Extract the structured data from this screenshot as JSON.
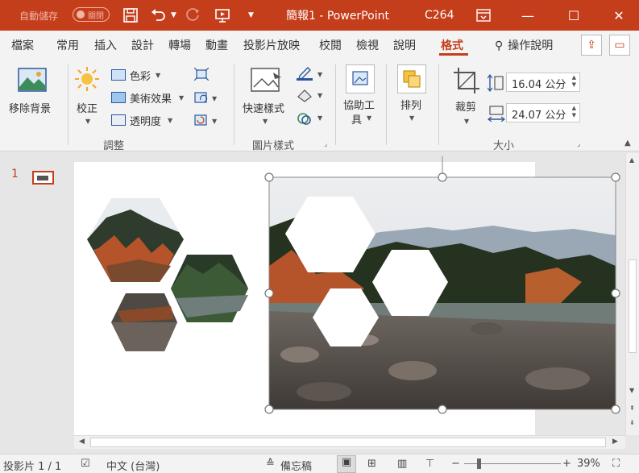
{
  "titlebar": {
    "autosave_label": "自動儲存",
    "autosave_state": "關閉",
    "doc_title": "簡報1 - PowerPoint",
    "user_code": "C264"
  },
  "tabs": [
    "檔案",
    "常用",
    "插入",
    "設計",
    "轉場",
    "動畫",
    "投影片放映",
    "校閱",
    "檢視",
    "說明",
    "格式"
  ],
  "active_tab": "格式",
  "help_search": "操作說明",
  "ribbon": {
    "remove_bg": "移除背景",
    "corrections": "校正",
    "color": "色彩",
    "artistic_effects": "美術效果",
    "transparency": "透明度",
    "adjust_group": "調整",
    "quick_styles": "快速樣式",
    "picture_styles_group": "圖片樣式",
    "accessibility_line1": "協助工",
    "accessibility_line2": "具",
    "arrange": "排列",
    "crop": "裁剪",
    "height_value": "16.04 公分",
    "width_value": "24.07 公分",
    "size_group": "大小"
  },
  "slide_number": "1",
  "status": {
    "slide_info": "投影片 1 / 1",
    "language": "中文 (台灣)",
    "notes": "備忘稿",
    "zoom": "39%"
  },
  "colors": {
    "accent": "#c43e1c",
    "ribbon_bg": "#f3f3f3",
    "workspace_bg": "#e6e6e6"
  }
}
